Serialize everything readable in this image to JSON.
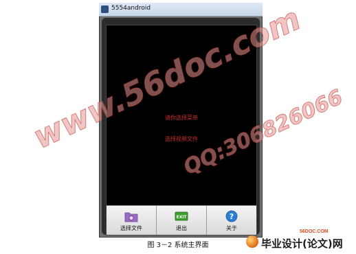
{
  "window": {
    "title": "5554android"
  },
  "screen": {
    "line1": "请你选择菜单",
    "line2": "选择视频文件"
  },
  "menu": {
    "items": [
      {
        "label": "选择文件",
        "icon": "camera-folder-icon"
      },
      {
        "label": "退出",
        "icon": "exit-icon"
      },
      {
        "label": "关于",
        "icon": "help-icon"
      }
    ]
  },
  "caption": "图 3－2 系统主界面",
  "watermarks": {
    "site": "www.56doc.com",
    "qq": "QQ:306826066"
  },
  "logo": {
    "domain": "56DOC.COM",
    "text": "毕业设计(论文)网"
  },
  "colors": {
    "screen_text": "#cc2a2a",
    "exit_green": "#3aa02a",
    "help_blue": "#2a7fd4",
    "folder_purple": "#9b6bc2",
    "watermark": "#e6968f"
  }
}
